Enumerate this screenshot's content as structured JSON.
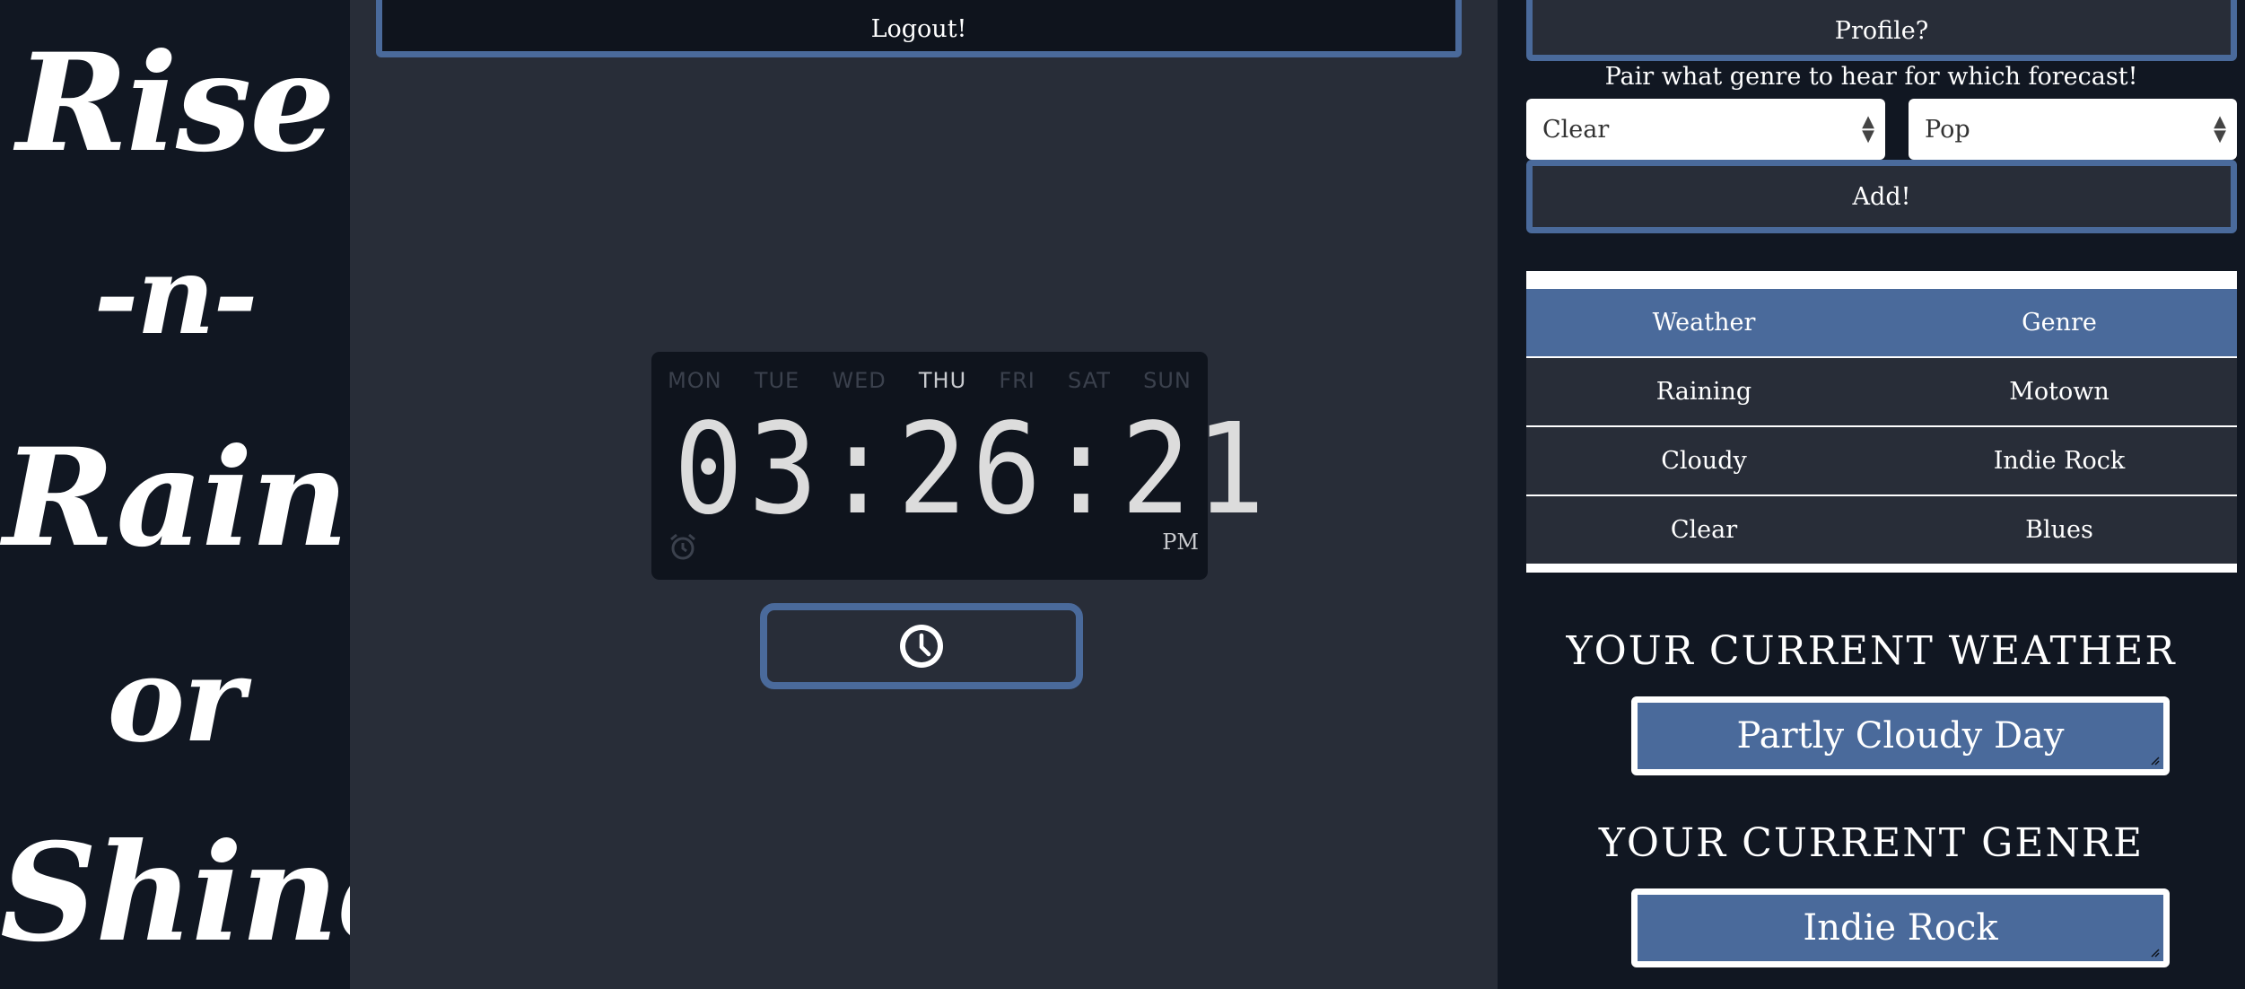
{
  "brand": {
    "line1": "Rise",
    "line2": "-n-",
    "line3": "Rain",
    "line4": "or",
    "line5": "Shine"
  },
  "header": {
    "logout_label": "Logout!",
    "profile_label": "Profile?"
  },
  "clock": {
    "days": [
      "MON",
      "TUE",
      "WED",
      "THU",
      "FRI",
      "SAT",
      "SUN"
    ],
    "active_day": "THU",
    "time": "03:26:21",
    "meridiem": "PM"
  },
  "pairing": {
    "prompt": "Pair what genre to hear for which forecast!",
    "weather_select": "Clear",
    "genre_select": "Pop",
    "add_label": "Add!"
  },
  "pair_table": {
    "headers": [
      "Weather",
      "Genre"
    ],
    "rows": [
      [
        "Raining",
        "Motown"
      ],
      [
        "Cloudy",
        "Indie Rock"
      ],
      [
        "Clear",
        "Blues"
      ]
    ]
  },
  "current": {
    "weather_title": "YOUR CURRENT WEATHER",
    "weather_value": "Partly Cloudy Day",
    "genre_title": "YOUR CURRENT GENRE",
    "genre_value": "Indie Rock"
  },
  "colors": {
    "accent": "#4a6a9b",
    "panel_dark": "#111722",
    "panel_mid": "#282d38"
  }
}
